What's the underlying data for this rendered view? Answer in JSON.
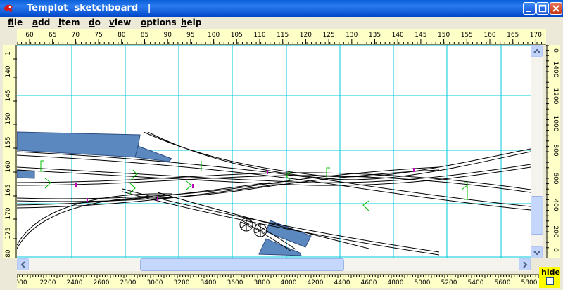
{
  "window": {
    "title": "Templot  sketchboard   |"
  },
  "menu": {
    "items": [
      {
        "label": "file",
        "name": "menu-file"
      },
      {
        "label": "add",
        "name": "menu-add"
      },
      {
        "label": "item",
        "name": "menu-item"
      },
      {
        "label": "do",
        "name": "menu-do"
      },
      {
        "label": "view",
        "name": "menu-view"
      },
      {
        "label": "options",
        "name": "menu-options"
      },
      {
        "label": "help",
        "name": "menu-help"
      }
    ]
  },
  "rulers": {
    "top": [
      "60",
      "65",
      "70",
      "75",
      "80",
      "85",
      "90",
      "95",
      "100",
      "105",
      "110",
      "115",
      "120",
      "125",
      "130",
      "135",
      "140",
      "145",
      "150",
      "155",
      "160",
      "165",
      "170"
    ],
    "left": [
      "1",
      "140",
      "145",
      "150",
      "155",
      "160",
      "165",
      "170",
      "175",
      "180"
    ],
    "right": [
      "0",
      "1400",
      "1200",
      "1000",
      "800",
      "600",
      "400",
      "200",
      "0"
    ],
    "bottom": [
      "000",
      "2200",
      "2400",
      "2600",
      "2800",
      "3000",
      "3200",
      "3400",
      "3600",
      "3800",
      "4000",
      "4200",
      "4400",
      "4600",
      "4800",
      "5000",
      "5200",
      "5400",
      "5600",
      "5800"
    ]
  },
  "hide_panel": {
    "label": "hide"
  },
  "colors": {
    "grid": "#00c8d8",
    "track": "#000000",
    "template_fill": "#5c88c0",
    "timber_marks": "#00c000",
    "rail_marks": "#c000c0",
    "ruler_bg": "#ffffc8"
  }
}
